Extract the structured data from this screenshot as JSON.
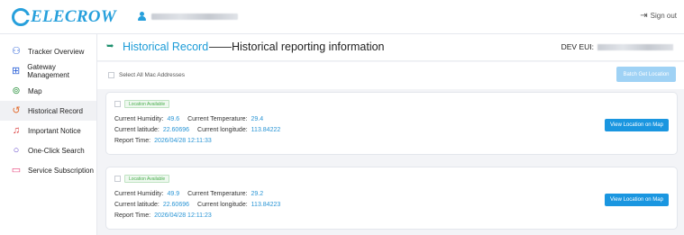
{
  "brand": {
    "name": "ELECROW",
    "accent": "#27a0dc"
  },
  "topbar": {
    "user_icon": "user-icon",
    "signout_label": "Sign out",
    "signout_icon": "sign-out-icon"
  },
  "sidebar": {
    "items": [
      {
        "label": "Tracker Overview",
        "icon": "tracker-icon",
        "active": false
      },
      {
        "label": "Gateway Management",
        "icon": "gateway-icon",
        "active": false
      },
      {
        "label": "Map",
        "icon": "map-icon",
        "active": false
      },
      {
        "label": "Historical Record",
        "icon": "history-icon",
        "active": true
      },
      {
        "label": "Important Notice",
        "icon": "bell-icon",
        "active": false
      },
      {
        "label": "One-Click Search",
        "icon": "search-icon",
        "active": false
      },
      {
        "label": "Service Subscription",
        "icon": "subscription-icon",
        "active": false
      }
    ]
  },
  "header": {
    "title": "Historical Record",
    "subtitle": "——Historical reporting information",
    "dev_eui_label": "DEV EUI:"
  },
  "toolbar": {
    "select_all_label": "Select All Mac Addresses",
    "batch_button_label": "Batch Get Location"
  },
  "records": [
    {
      "badge": "Location Available",
      "humidity_label": "Current Humidity:",
      "humidity": "49.6",
      "temperature_label": "Current Temperature:",
      "temperature": "29.4",
      "latitude_label": "Current latitude:",
      "latitude": "22.60696",
      "longitude_label": "Current longitude:",
      "longitude": "113.84222",
      "time_label": "Report Time:",
      "time": "2026/04/28 12:11:33",
      "button_label": "View Location on Map"
    },
    {
      "badge": "Location Available",
      "humidity_label": "Current Humidity:",
      "humidity": "49.9",
      "temperature_label": "Current Temperature:",
      "temperature": "29.2",
      "latitude_label": "Current latitude:",
      "latitude": "22.60696",
      "longitude_label": "Current longitude:",
      "longitude": "113.84223",
      "time_label": "Report Time:",
      "time": "2026/04/28 12:11:23",
      "button_label": "View Location on Map"
    }
  ]
}
